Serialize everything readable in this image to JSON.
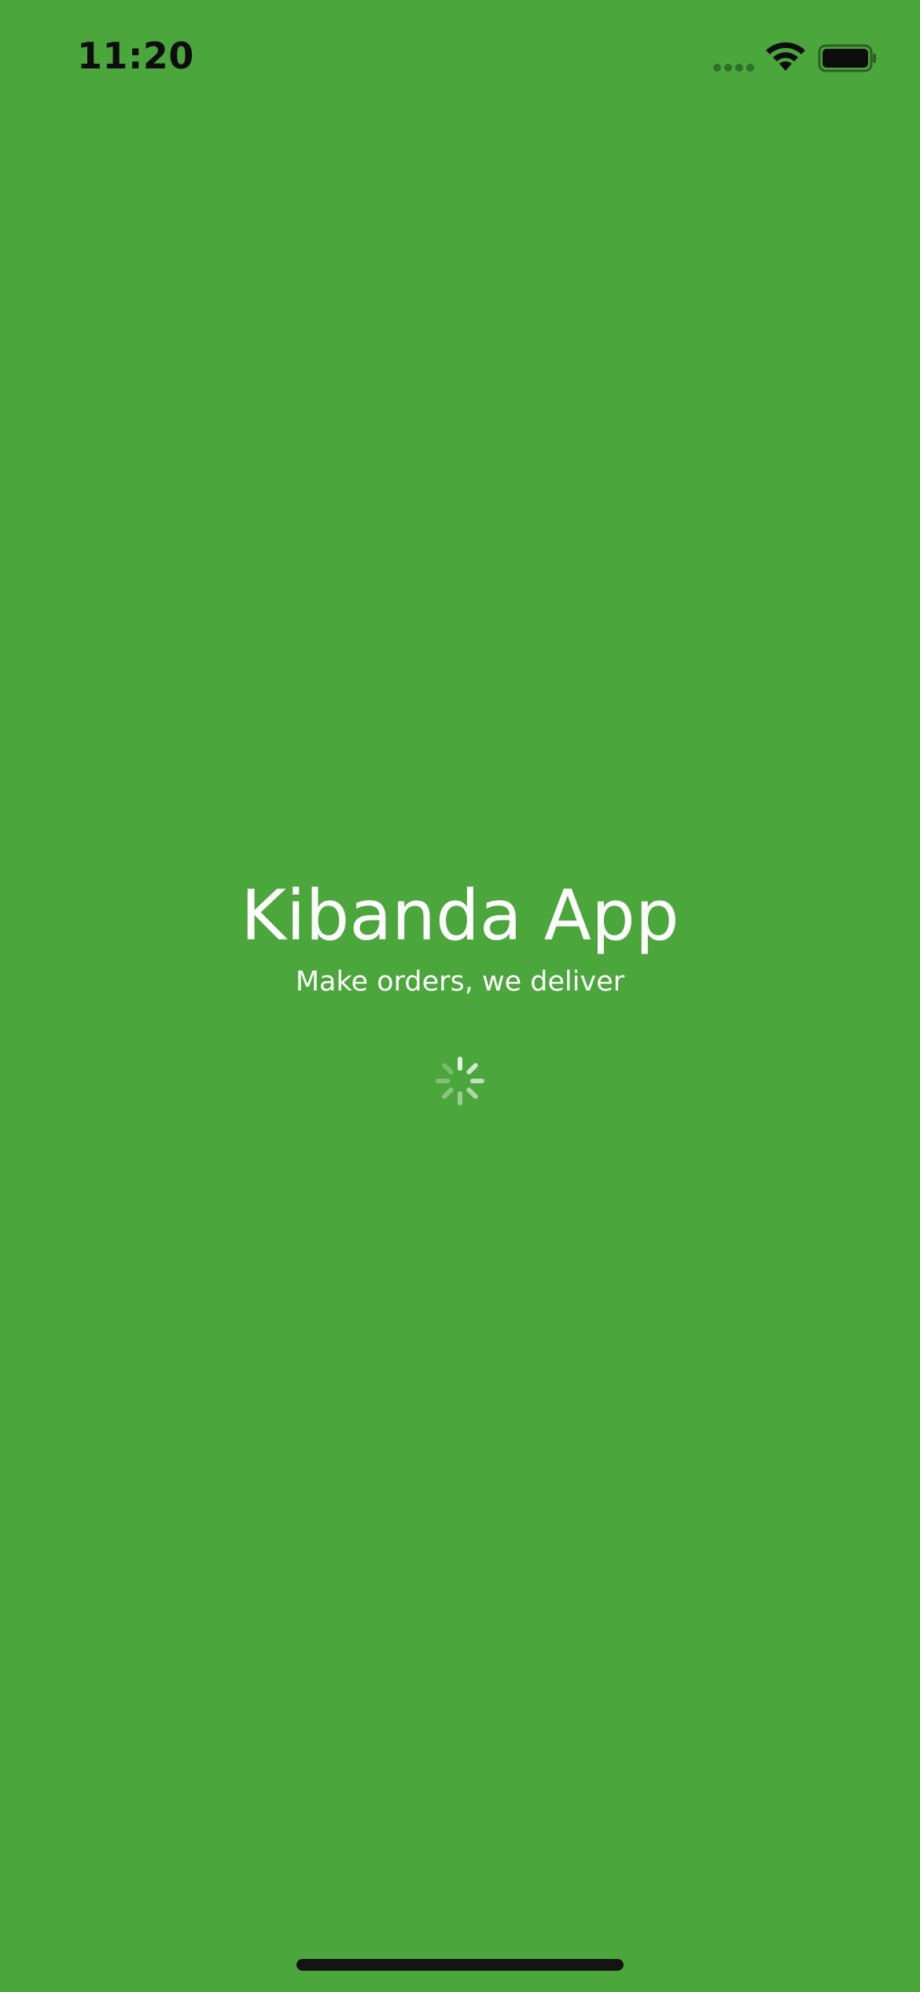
{
  "status_bar": {
    "time": "11:20",
    "signal_icon": "cellular-signal-icon",
    "wifi_icon": "wifi-icon",
    "battery_icon": "battery-full-icon"
  },
  "splash": {
    "title": "Kibanda App",
    "tagline": "Make orders, we deliver",
    "loading_icon": "activity-spinner-icon"
  },
  "colors": {
    "background": "#4ba63c",
    "text": "#ffffff",
    "status_text": "#0d0d0d",
    "home_indicator": "#141414"
  }
}
